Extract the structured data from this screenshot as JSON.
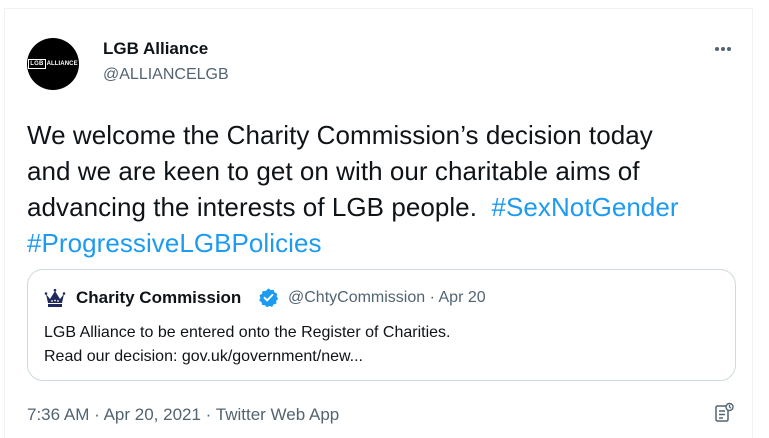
{
  "author": {
    "display_name": "LGB Alliance",
    "handle": "@ALLIANCELGB",
    "avatar_box_text": "LGB",
    "avatar_text": "ALLIANCE"
  },
  "tweet": {
    "lines": [
      "We welcome the Charity Commission’s decision today",
      "and we are keen to get on with our charitable aims of",
      "advancing the interests of LGB people.  "
    ],
    "hashtag_1": "#SexNotGender",
    "hashtag_2": "#ProgressiveLGBPolicies"
  },
  "quote": {
    "display_name": "Charity Commission",
    "handle": "@ChtyCommission",
    "separator": "·",
    "date": "Apr 20",
    "line_1": "LGB Alliance to be entered onto the Register of Charities.",
    "line_2": "Read our decision: gov.uk/government/new..."
  },
  "footer": {
    "time": "7:36 AM",
    "date": "Apr 20, 2021",
    "separator": "·",
    "source": "Twitter Web App"
  },
  "icons": {
    "more": "more-horizontal-icon",
    "verified": "verified-badge-icon",
    "quote_avatar": "crown-icon",
    "analytics": "analytics-icon"
  },
  "colors": {
    "link": "#1d9bf0",
    "secondary_text": "#536471",
    "primary_text": "#0f1419",
    "border": "#cfd9de"
  }
}
